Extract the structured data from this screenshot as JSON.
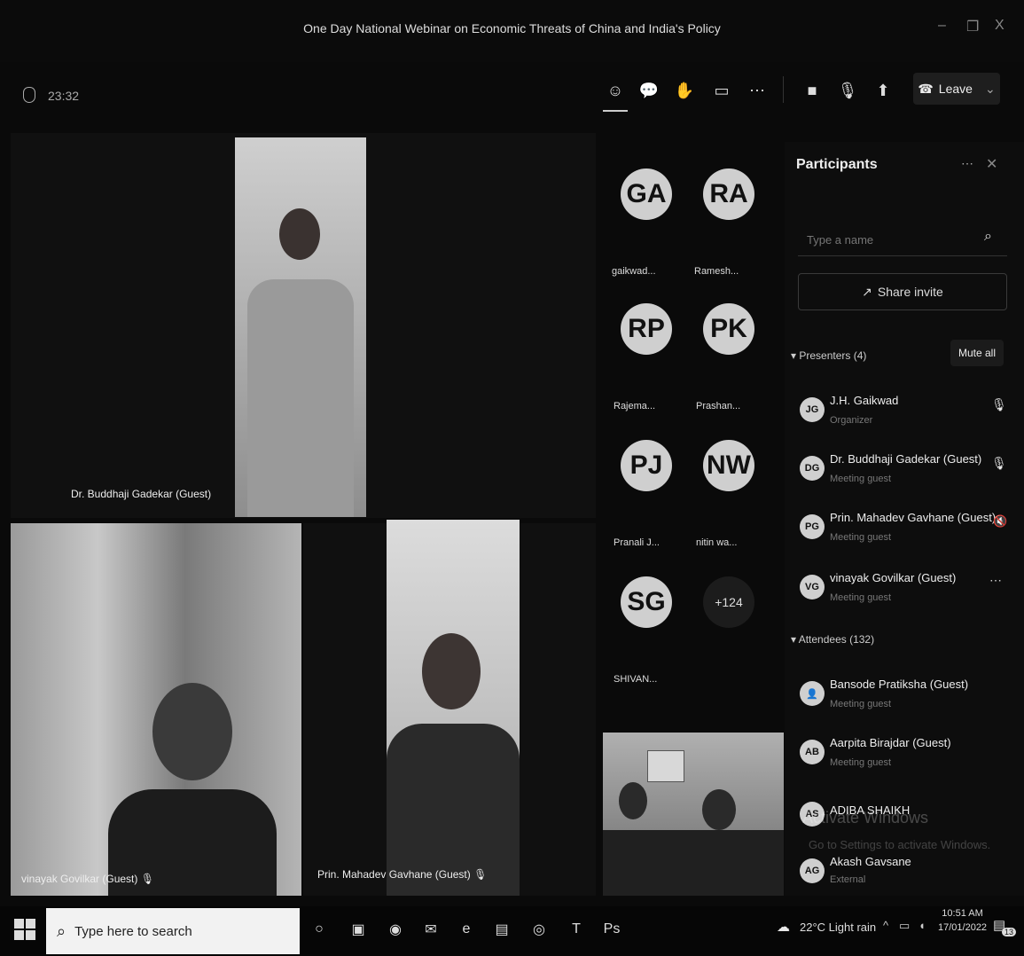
{
  "window": {
    "title": "One Day National Webinar on Economic Threats of China and India's Policy",
    "minimize": "–",
    "restore": "❐",
    "close": "X"
  },
  "meeting": {
    "timer": "23:32",
    "leave_label": "Leave"
  },
  "toolbar_icons": [
    "participants-icon",
    "chat-icon",
    "reactions-icon",
    "rooms-icon",
    "more-icon",
    "camera-icon",
    "mic-icon",
    "share-icon"
  ],
  "videos": {
    "top": {
      "label": "Dr. Buddhaji Gadekar (Guest)"
    },
    "bottom_left": {
      "label": "vinayak Govilkar (Guest)"
    },
    "bottom_mid": {
      "label": "Prin. Mahadev Gavhane (Guest)"
    }
  },
  "avatars": [
    {
      "initials": "GA",
      "name": "gaikwad..."
    },
    {
      "initials": "RA",
      "name": "Ramesh..."
    },
    {
      "initials": "RP",
      "name": "Rajema..."
    },
    {
      "initials": "PK",
      "name": "Prashan..."
    },
    {
      "initials": "PJ",
      "name": "Pranali J..."
    },
    {
      "initials": "NW",
      "name": "nitin wa..."
    },
    {
      "initials": "SG",
      "name": "SHIVAN..."
    },
    {
      "initials": "+124",
      "name": ""
    }
  ],
  "panel": {
    "title": "Participants",
    "search_placeholder": "Type a name",
    "share_invite": "Share invite",
    "presenters_label": "Presenters (4)",
    "mute_all": "Mute all",
    "presenters": [
      {
        "initials": "JG",
        "name": "J.H. Gaikwad",
        "role": "Organizer"
      },
      {
        "initials": "DG",
        "name": "Dr. Buddhaji Gadekar (Guest)",
        "role": "Meeting guest"
      },
      {
        "initials": "PG",
        "name": "Prin. Mahadev Gavhane (Guest)",
        "role": "Meeting guest"
      },
      {
        "initials": "VG",
        "name": "vinayak Govilkar (Guest)",
        "role": "Meeting guest"
      }
    ],
    "attendees_label": "Attendees (132)",
    "attendees": [
      {
        "initials": "",
        "name": "Bansode Pratiksha (Guest)",
        "role": "Meeting guest"
      },
      {
        "initials": "AB",
        "name": "Aarpita Birajdar (Guest)",
        "role": "Meeting guest"
      },
      {
        "initials": "AS",
        "name": "ADIBA SHAIKH",
        "role": ""
      },
      {
        "initials": "AG",
        "name": "Akash Gavsane",
        "role": "External"
      }
    ]
  },
  "watermark": {
    "line1": "Activate Windows",
    "line2": "Go to Settings to activate Windows."
  },
  "taskbar": {
    "search_placeholder": "Type here to search",
    "weather": "22°C Light rain",
    "time": "10:51 AM",
    "date": "17/01/2022",
    "notif_count": "13"
  }
}
